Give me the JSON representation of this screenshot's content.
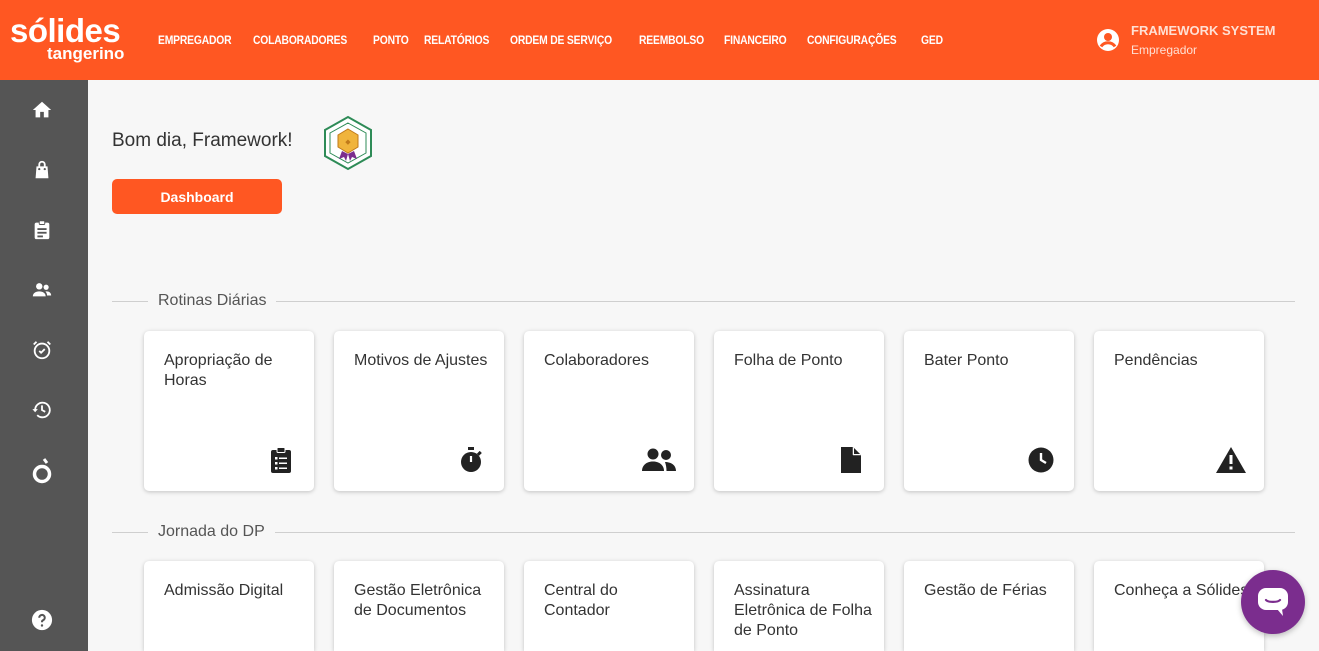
{
  "logo": {
    "line1": "sólides",
    "line2": "tangerino"
  },
  "nav": [
    "EMPREGADOR",
    "COLABORADORES",
    "PONTO",
    "RELATÓRIOS",
    "ORDEM DE SERVIÇO",
    "REEMBOLSO",
    "FINANCEIRO",
    "CONFIGURAÇÕES",
    "GED"
  ],
  "user": {
    "name": "FRAMEWORK SYSTEM",
    "role": "Empregador",
    "icon": "account-circle-icon"
  },
  "sidebar": {
    "icons": [
      "home-icon",
      "shopping-bag-icon",
      "clipboard-icon",
      "users-icon",
      "alarm-icon",
      "history-icon",
      "solides-logo-icon",
      "help-icon"
    ]
  },
  "main": {
    "greeting": "Bom dia, Framework!",
    "dashboard_label": "Dashboard",
    "sections": [
      {
        "title": "Rotinas Diárias",
        "cards": [
          {
            "title": "Apropriação de Horas",
            "icon": "clipboard-list-icon"
          },
          {
            "title": "Motivos de Ajustes",
            "icon": "stopwatch-icon"
          },
          {
            "title": "Colaboradores",
            "icon": "users-icon"
          },
          {
            "title": "Folha de Ponto",
            "icon": "file-icon"
          },
          {
            "title": "Bater Ponto",
            "icon": "clock-icon"
          },
          {
            "title": "Pendências",
            "icon": "warning-icon"
          }
        ]
      },
      {
        "title": "Jornada do DP",
        "cards": [
          {
            "title": "Admissão Digital"
          },
          {
            "title": "Gestão Eletrônica de Documentos"
          },
          {
            "title": "Central do Contador"
          },
          {
            "title": "Assinatura Eletrônica de Folha de Ponto"
          },
          {
            "title": "Gestão de Férias"
          },
          {
            "title": "Conheça a Sólides"
          }
        ]
      }
    ]
  },
  "colors": {
    "brand": "#ff5722",
    "sidebar": "#555555",
    "chat": "#7b2d8e"
  }
}
